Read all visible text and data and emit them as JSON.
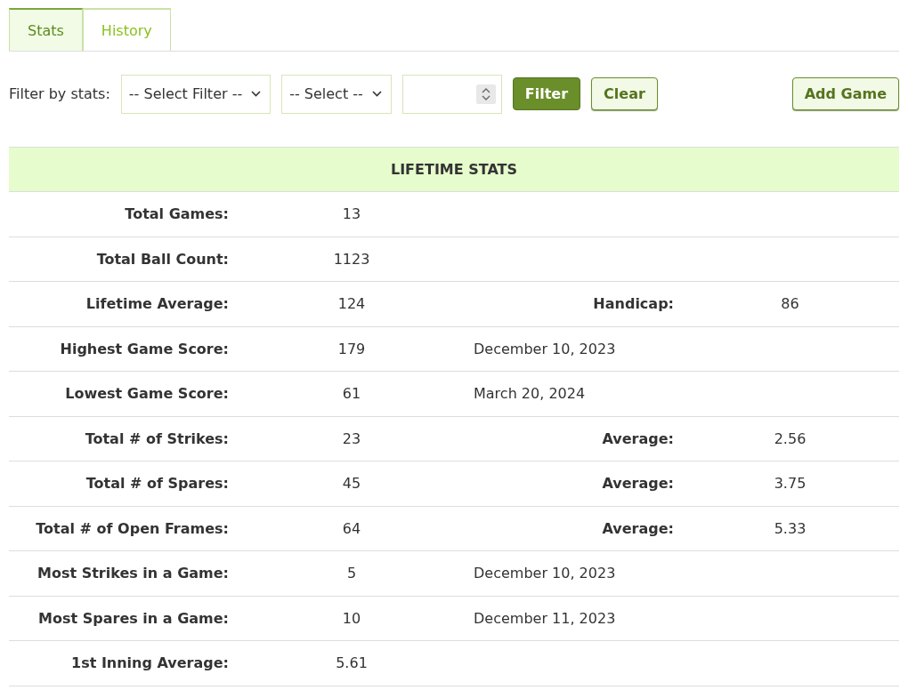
{
  "tabs": [
    {
      "label": "Stats",
      "selected": true
    },
    {
      "label": "History",
      "selected": false
    }
  ],
  "filter": {
    "label": "Filter by stats:",
    "selects": [
      "-- Select Filter --",
      "-- Select --"
    ],
    "buttons": [
      {
        "label": "Filter",
        "kind": "primary"
      },
      {
        "label": "Clear",
        "kind": "secondary"
      }
    ],
    "add_button": "Add Game"
  },
  "table": {
    "title": "LIFETIME STATS",
    "rows": [
      {
        "label": "Total Games:",
        "value": "13"
      },
      {
        "label": "Total Ball Count:",
        "value": "1123"
      },
      {
        "label": "Lifetime Average:",
        "value": "124",
        "extra": {
          "kind": "stat",
          "label": "Handicap:",
          "value": "86"
        }
      },
      {
        "label": "Highest Game Score:",
        "value": "179",
        "extra": {
          "kind": "date",
          "text": "December 10, 2023"
        }
      },
      {
        "label": "Lowest Game Score:",
        "value": "61",
        "extra": {
          "kind": "date",
          "text": "March 20, 2024"
        }
      },
      {
        "label": "Total # of Strikes:",
        "value": "23",
        "extra": {
          "kind": "stat",
          "label": "Average:",
          "value": "2.56"
        }
      },
      {
        "label": "Total # of Spares:",
        "value": "45",
        "extra": {
          "kind": "stat",
          "label": "Average:",
          "value": "3.75"
        }
      },
      {
        "label": "Total # of Open Frames:",
        "value": "64",
        "extra": {
          "kind": "stat",
          "label": "Average:",
          "value": "5.33"
        }
      },
      {
        "label": "Most Strikes in a Game:",
        "value": "5",
        "extra": {
          "kind": "date",
          "text": "December 10, 2023"
        }
      },
      {
        "label": "Most Spares in a Game:",
        "value": "10",
        "extra": {
          "kind": "date",
          "text": "December 11, 2023"
        }
      },
      {
        "label": "1st Inning Average:",
        "value": "5.61"
      }
    ]
  }
}
